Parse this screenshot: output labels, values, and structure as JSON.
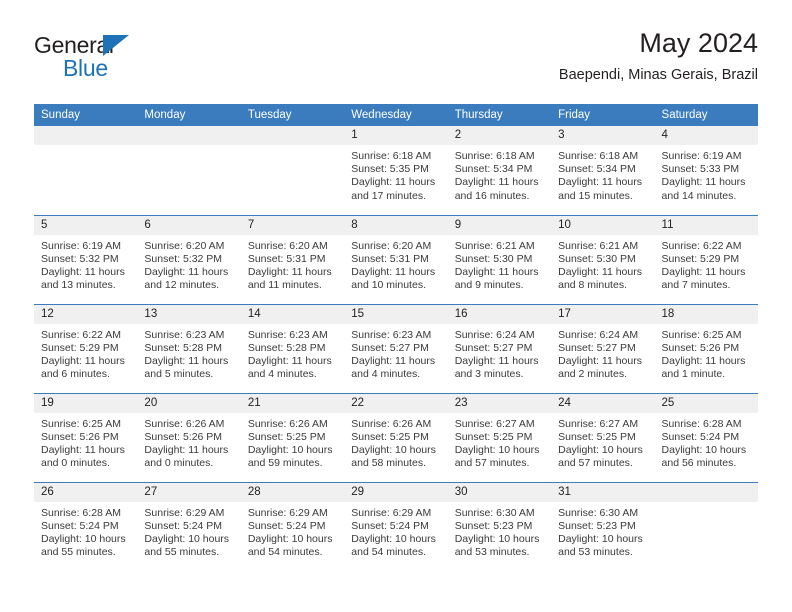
{
  "brand": {
    "name_part1": "General",
    "name_part2": "Blue",
    "triangle_color": "#1d72b8",
    "logo_icon": "general-blue-logo"
  },
  "header": {
    "title": "May 2024",
    "subtitle": "Baependi, Minas Gerais, Brazil"
  },
  "theme": {
    "header_blue": "#3a7cbe",
    "daynum_band": "#f0f0f0",
    "text": "#231f20",
    "body_text": "#3a3a3a"
  },
  "weekday_headers": [
    "Sunday",
    "Monday",
    "Tuesday",
    "Wednesday",
    "Thursday",
    "Friday",
    "Saturday"
  ],
  "weeks": [
    [
      {
        "day": "",
        "empty": true
      },
      {
        "day": "",
        "empty": true
      },
      {
        "day": "",
        "empty": true
      },
      {
        "day": "1",
        "sunrise": "Sunrise: 6:18 AM",
        "sunset": "Sunset: 5:35 PM",
        "daylight": "Daylight: 11 hours and 17 minutes."
      },
      {
        "day": "2",
        "sunrise": "Sunrise: 6:18 AM",
        "sunset": "Sunset: 5:34 PM",
        "daylight": "Daylight: 11 hours and 16 minutes."
      },
      {
        "day": "3",
        "sunrise": "Sunrise: 6:18 AM",
        "sunset": "Sunset: 5:34 PM",
        "daylight": "Daylight: 11 hours and 15 minutes."
      },
      {
        "day": "4",
        "sunrise": "Sunrise: 6:19 AM",
        "sunset": "Sunset: 5:33 PM",
        "daylight": "Daylight: 11 hours and 14 minutes."
      }
    ],
    [
      {
        "day": "5",
        "sunrise": "Sunrise: 6:19 AM",
        "sunset": "Sunset: 5:32 PM",
        "daylight": "Daylight: 11 hours and 13 minutes."
      },
      {
        "day": "6",
        "sunrise": "Sunrise: 6:20 AM",
        "sunset": "Sunset: 5:32 PM",
        "daylight": "Daylight: 11 hours and 12 minutes."
      },
      {
        "day": "7",
        "sunrise": "Sunrise: 6:20 AM",
        "sunset": "Sunset: 5:31 PM",
        "daylight": "Daylight: 11 hours and 11 minutes."
      },
      {
        "day": "8",
        "sunrise": "Sunrise: 6:20 AM",
        "sunset": "Sunset: 5:31 PM",
        "daylight": "Daylight: 11 hours and 10 minutes."
      },
      {
        "day": "9",
        "sunrise": "Sunrise: 6:21 AM",
        "sunset": "Sunset: 5:30 PM",
        "daylight": "Daylight: 11 hours and 9 minutes."
      },
      {
        "day": "10",
        "sunrise": "Sunrise: 6:21 AM",
        "sunset": "Sunset: 5:30 PM",
        "daylight": "Daylight: 11 hours and 8 minutes."
      },
      {
        "day": "11",
        "sunrise": "Sunrise: 6:22 AM",
        "sunset": "Sunset: 5:29 PM",
        "daylight": "Daylight: 11 hours and 7 minutes."
      }
    ],
    [
      {
        "day": "12",
        "sunrise": "Sunrise: 6:22 AM",
        "sunset": "Sunset: 5:29 PM",
        "daylight": "Daylight: 11 hours and 6 minutes."
      },
      {
        "day": "13",
        "sunrise": "Sunrise: 6:23 AM",
        "sunset": "Sunset: 5:28 PM",
        "daylight": "Daylight: 11 hours and 5 minutes."
      },
      {
        "day": "14",
        "sunrise": "Sunrise: 6:23 AM",
        "sunset": "Sunset: 5:28 PM",
        "daylight": "Daylight: 11 hours and 4 minutes."
      },
      {
        "day": "15",
        "sunrise": "Sunrise: 6:23 AM",
        "sunset": "Sunset: 5:27 PM",
        "daylight": "Daylight: 11 hours and 4 minutes."
      },
      {
        "day": "16",
        "sunrise": "Sunrise: 6:24 AM",
        "sunset": "Sunset: 5:27 PM",
        "daylight": "Daylight: 11 hours and 3 minutes."
      },
      {
        "day": "17",
        "sunrise": "Sunrise: 6:24 AM",
        "sunset": "Sunset: 5:27 PM",
        "daylight": "Daylight: 11 hours and 2 minutes."
      },
      {
        "day": "18",
        "sunrise": "Sunrise: 6:25 AM",
        "sunset": "Sunset: 5:26 PM",
        "daylight": "Daylight: 11 hours and 1 minute."
      }
    ],
    [
      {
        "day": "19",
        "sunrise": "Sunrise: 6:25 AM",
        "sunset": "Sunset: 5:26 PM",
        "daylight": "Daylight: 11 hours and 0 minutes."
      },
      {
        "day": "20",
        "sunrise": "Sunrise: 6:26 AM",
        "sunset": "Sunset: 5:26 PM",
        "daylight": "Daylight: 11 hours and 0 minutes."
      },
      {
        "day": "21",
        "sunrise": "Sunrise: 6:26 AM",
        "sunset": "Sunset: 5:25 PM",
        "daylight": "Daylight: 10 hours and 59 minutes."
      },
      {
        "day": "22",
        "sunrise": "Sunrise: 6:26 AM",
        "sunset": "Sunset: 5:25 PM",
        "daylight": "Daylight: 10 hours and 58 minutes."
      },
      {
        "day": "23",
        "sunrise": "Sunrise: 6:27 AM",
        "sunset": "Sunset: 5:25 PM",
        "daylight": "Daylight: 10 hours and 57 minutes."
      },
      {
        "day": "24",
        "sunrise": "Sunrise: 6:27 AM",
        "sunset": "Sunset: 5:25 PM",
        "daylight": "Daylight: 10 hours and 57 minutes."
      },
      {
        "day": "25",
        "sunrise": "Sunrise: 6:28 AM",
        "sunset": "Sunset: 5:24 PM",
        "daylight": "Daylight: 10 hours and 56 minutes."
      }
    ],
    [
      {
        "day": "26",
        "sunrise": "Sunrise: 6:28 AM",
        "sunset": "Sunset: 5:24 PM",
        "daylight": "Daylight: 10 hours and 55 minutes."
      },
      {
        "day": "27",
        "sunrise": "Sunrise: 6:29 AM",
        "sunset": "Sunset: 5:24 PM",
        "daylight": "Daylight: 10 hours and 55 minutes."
      },
      {
        "day": "28",
        "sunrise": "Sunrise: 6:29 AM",
        "sunset": "Sunset: 5:24 PM",
        "daylight": "Daylight: 10 hours and 54 minutes."
      },
      {
        "day": "29",
        "sunrise": "Sunrise: 6:29 AM",
        "sunset": "Sunset: 5:24 PM",
        "daylight": "Daylight: 10 hours and 54 minutes."
      },
      {
        "day": "30",
        "sunrise": "Sunrise: 6:30 AM",
        "sunset": "Sunset: 5:23 PM",
        "daylight": "Daylight: 10 hours and 53 minutes."
      },
      {
        "day": "31",
        "sunrise": "Sunrise: 6:30 AM",
        "sunset": "Sunset: 5:23 PM",
        "daylight": "Daylight: 10 hours and 53 minutes."
      },
      {
        "day": "",
        "empty": true
      }
    ]
  ]
}
